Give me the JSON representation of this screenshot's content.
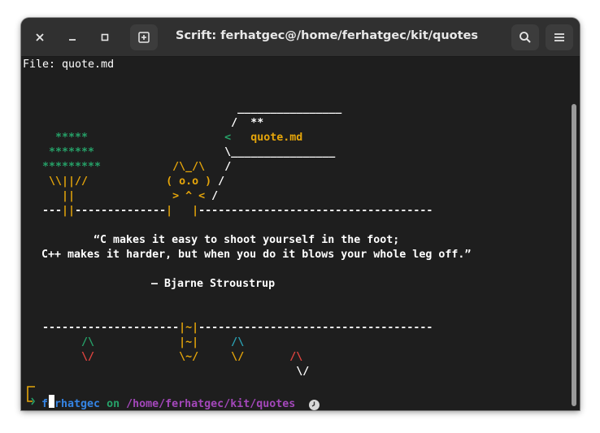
{
  "window": {
    "title": "Scrift: ferhatgec@/home/ferhatgec/kit/quotes"
  },
  "terminal": {
    "file_header": "File: quote.md",
    "art": [
      "                                 ________________",
      "                                /  **",
      "     *****                     <   quote.md",
      "    *******                    \\________________",
      "   *********           /\\_/\\   /",
      "    \\\\||//            ( o.o ) /",
      "      ||               > ^ < /",
      "   ---||--------------|   |------------------------------------",
      "",
      "          “C makes it easy to shoot yourself in the foot;",
      "   C++ makes it harder, but when you do it blows your whole leg off.”",
      "",
      "                    — Bjarne Stroustrup",
      "",
      "",
      "   ---------------------|~|------------------------------------",
      "         /\\             |~|     /\\",
      "         \\/             \\~/     \\/       /\\",
      "                                          \\/"
    ],
    "speech_text": "quote.md",
    "quote_line1": "“C makes it easy to shoot yourself in the foot;",
    "quote_line2": "C++ makes it harder, but when you do it blows your whole leg off.”",
    "author": "— Bjarne Stroustrup",
    "prompt": {
      "user": "ferhatgec",
      "on": "on",
      "path": "/home/ferhatgec/kit/quotes",
      "clock_icon": "clock-icon"
    }
  },
  "colors": {
    "green": "#26a269",
    "yellow": "#e5a50a",
    "cyan": "#2aa1b3",
    "red": "#e0443f",
    "purple": "#a347ba",
    "blue": "#3584e4"
  }
}
